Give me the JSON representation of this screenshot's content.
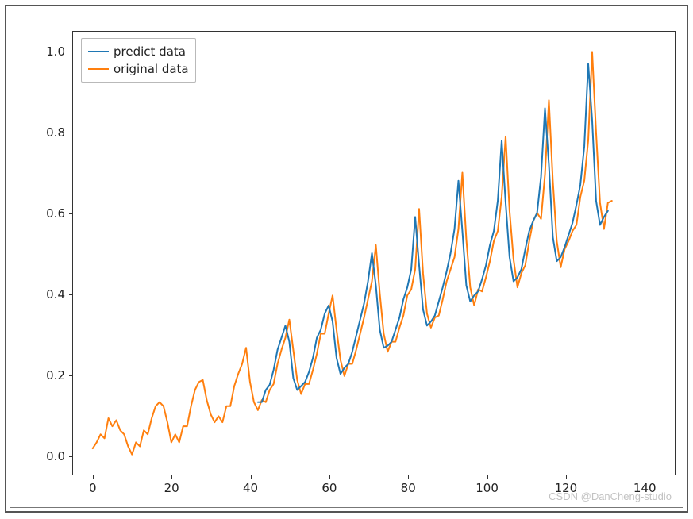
{
  "legend": {
    "predict": "predict data",
    "original": "original data"
  },
  "colors": {
    "predict": "#1f77b4",
    "original": "#ff7f0e"
  },
  "watermark": "CSDN @DanCheng-studio",
  "yticks": [
    "0.0",
    "0.2",
    "0.4",
    "0.6",
    "0.8",
    "1.0"
  ],
  "xticks": [
    "0",
    "20",
    "40",
    "60",
    "80",
    "100",
    "120",
    "140"
  ],
  "chart_data": {
    "type": "line",
    "xlabel": "",
    "ylabel": "",
    "title": "",
    "xlim": [
      -5,
      148
    ],
    "ylim": [
      -0.05,
      1.05
    ],
    "legend_position": "upper left",
    "grid": false,
    "series": [
      {
        "name": "original data",
        "color": "#ff7f0e",
        "x_start": 0,
        "values": [
          0.015,
          0.03,
          0.05,
          0.04,
          0.09,
          0.07,
          0.085,
          0.06,
          0.05,
          0.02,
          0.0,
          0.03,
          0.02,
          0.06,
          0.05,
          0.09,
          0.12,
          0.13,
          0.12,
          0.08,
          0.03,
          0.05,
          0.03,
          0.07,
          0.07,
          0.12,
          0.16,
          0.18,
          0.185,
          0.135,
          0.1,
          0.08,
          0.095,
          0.08,
          0.12,
          0.12,
          0.17,
          0.2,
          0.225,
          0.265,
          0.18,
          0.13,
          0.11,
          0.135,
          0.13,
          0.16,
          0.175,
          0.225,
          0.26,
          0.29,
          0.335,
          0.26,
          0.185,
          0.15,
          0.175,
          0.175,
          0.21,
          0.25,
          0.3,
          0.3,
          0.35,
          0.395,
          0.31,
          0.235,
          0.195,
          0.225,
          0.225,
          0.26,
          0.3,
          0.34,
          0.385,
          0.43,
          0.52,
          0.4,
          0.3,
          0.255,
          0.28,
          0.28,
          0.315,
          0.345,
          0.395,
          0.41,
          0.46,
          0.61,
          0.45,
          0.35,
          0.315,
          0.34,
          0.345,
          0.385,
          0.43,
          0.46,
          0.49,
          0.56,
          0.7,
          0.535,
          0.415,
          0.37,
          0.41,
          0.405,
          0.44,
          0.48,
          0.53,
          0.555,
          0.64,
          0.79,
          0.605,
          0.485,
          0.415,
          0.45,
          0.47,
          0.53,
          0.58,
          0.6,
          0.585,
          0.695,
          0.88,
          0.68,
          0.53,
          0.465,
          0.51,
          0.53,
          0.555,
          0.57,
          0.64,
          0.68,
          0.78,
          1.0,
          0.8,
          0.625,
          0.56,
          0.625,
          0.63
        ]
      },
      {
        "name": "predict data",
        "color": "#1f77b4",
        "x_start": 42,
        "values": [
          0.13,
          0.13,
          0.16,
          0.173,
          0.21,
          0.26,
          0.29,
          0.32,
          0.28,
          0.19,
          0.16,
          0.17,
          0.18,
          0.205,
          0.24,
          0.29,
          0.31,
          0.35,
          0.37,
          0.33,
          0.24,
          0.2,
          0.215,
          0.225,
          0.255,
          0.295,
          0.335,
          0.375,
          0.43,
          0.5,
          0.42,
          0.31,
          0.265,
          0.27,
          0.28,
          0.31,
          0.34,
          0.385,
          0.415,
          0.46,
          0.59,
          0.47,
          0.36,
          0.32,
          0.33,
          0.345,
          0.38,
          0.415,
          0.455,
          0.5,
          0.56,
          0.68,
          0.555,
          0.42,
          0.38,
          0.395,
          0.405,
          0.435,
          0.47,
          0.52,
          0.555,
          0.63,
          0.78,
          0.625,
          0.49,
          0.43,
          0.44,
          0.46,
          0.51,
          0.555,
          0.58,
          0.6,
          0.69,
          0.86,
          0.72,
          0.54,
          0.48,
          0.49,
          0.515,
          0.545,
          0.575,
          0.62,
          0.67,
          0.765,
          0.97,
          0.83,
          0.63,
          0.57,
          0.59,
          0.605
        ]
      }
    ]
  }
}
